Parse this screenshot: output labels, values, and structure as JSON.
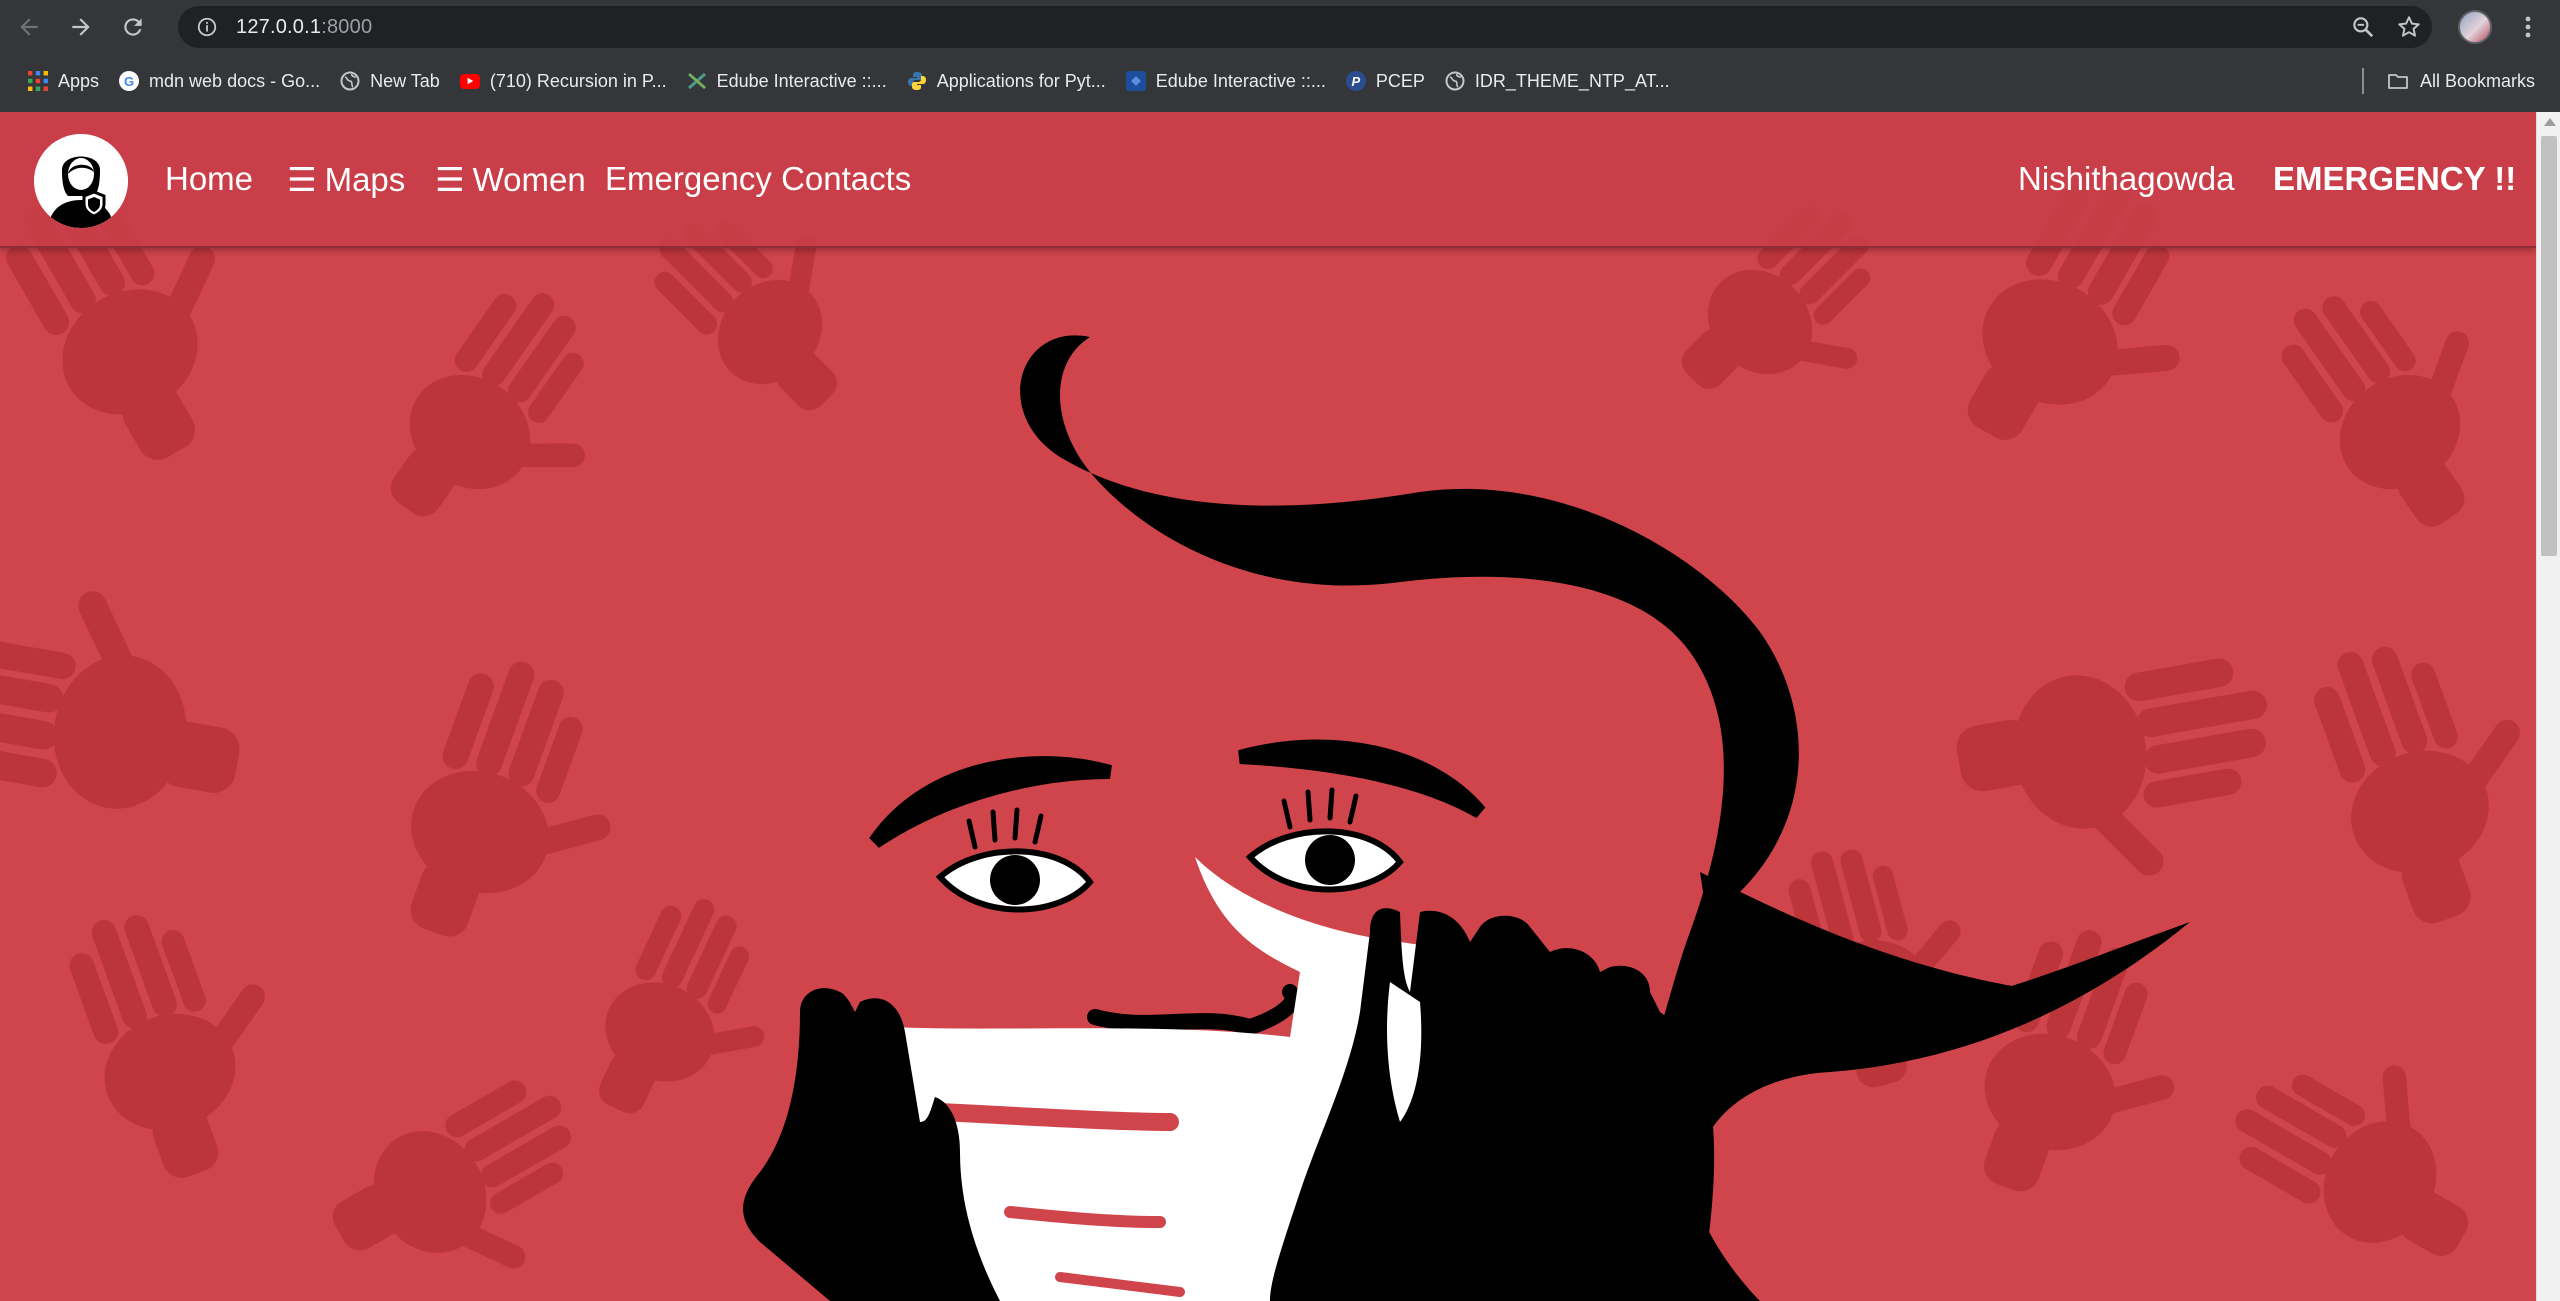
{
  "browser": {
    "url_host": "127.0.0.1",
    "url_port": ":8000",
    "icons": [
      "back-icon",
      "forward-icon",
      "reload-icon",
      "info-icon",
      "zoom-icon",
      "star-icon",
      "profile-avatar",
      "menu-icon"
    ]
  },
  "bookmarks": [
    {
      "label": "Apps",
      "icon": "apps-grid-icon"
    },
    {
      "label": "mdn web docs - Go...",
      "icon": "google-icon"
    },
    {
      "label": "New Tab",
      "icon": "globe-icon"
    },
    {
      "label": "(710) Recursion in P...",
      "icon": "youtube-icon"
    },
    {
      "label": "Edube Interactive ::...",
      "icon": "edube-icon"
    },
    {
      "label": "Applications for Pyt...",
      "icon": "python-icon"
    },
    {
      "label": "Edube Interactive ::...",
      "icon": "edube-blue-icon"
    },
    {
      "label": "PCEP",
      "icon": "pcep-icon"
    },
    {
      "label": "IDR_THEME_NTP_AT...",
      "icon": "globe-icon"
    }
  ],
  "all_bookmarks": "All Bookmarks",
  "site": {
    "nav": {
      "home": "Home",
      "menu_glyph": "☰",
      "maps": "Maps",
      "women": "Women",
      "contacts": "Emergency Contacts",
      "user": "Nishithagowda",
      "emergency": "EMERGENCY !!"
    },
    "colors": {
      "background": "#d0454b",
      "navbar": "#c83e48",
      "handprint": "#b93339",
      "figure": "#000000",
      "mask": "#ffffff"
    }
  }
}
